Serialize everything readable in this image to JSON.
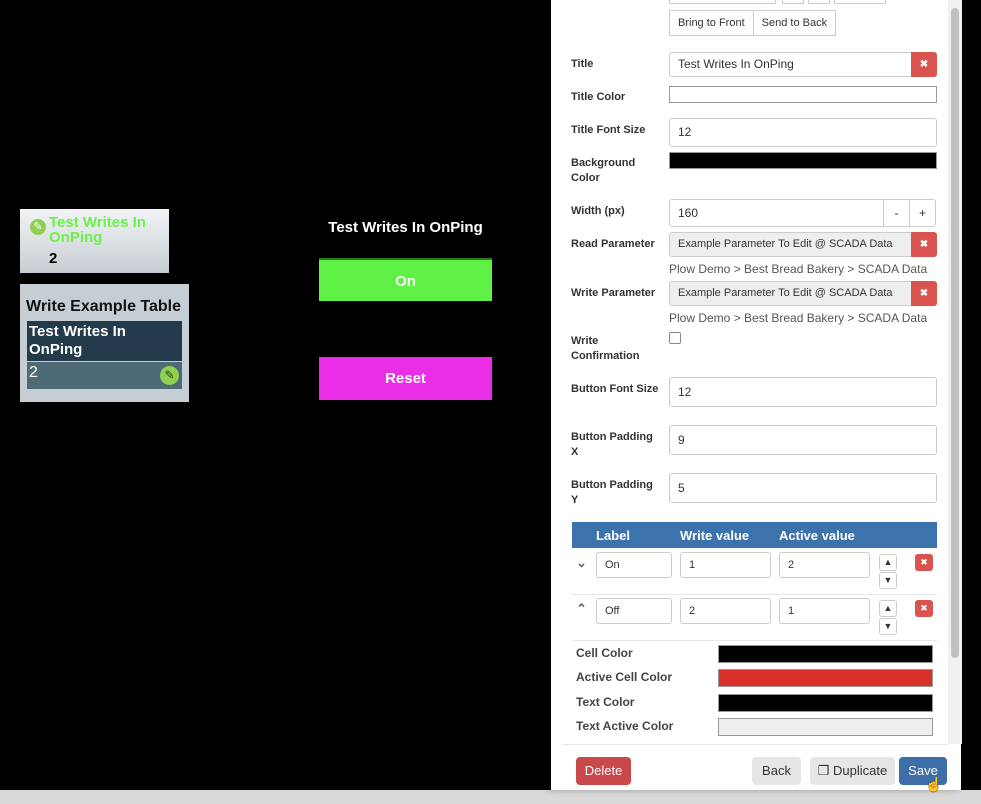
{
  "canvas": {
    "mini_card": {
      "title": "Test Writes In OnPing",
      "value": "2",
      "edit_icon": "pencil-icon"
    },
    "write_table": {
      "title": "Write Example Table",
      "header": "Test Writes In OnPing",
      "value": "2",
      "edit_icon": "pencil-icon"
    },
    "button_widget": {
      "title": "Test Writes In OnPing",
      "on_label": "On",
      "on_color": "#5ef045",
      "reset_label": "Reset",
      "reset_color": "#ea2ee8"
    }
  },
  "panel": {
    "order_buttons": [
      "Bring to Front",
      "Send to Back"
    ],
    "fields": {
      "title": {
        "label": "Title",
        "value": "Test Writes In OnPing"
      },
      "title_color": {
        "label": "Title Color",
        "value": "#ffffff"
      },
      "title_font_size": {
        "label": "Title Font Size",
        "value": "12"
      },
      "background_color": {
        "label": "Background Color",
        "value": "#000000"
      },
      "width": {
        "label": "Width (px)",
        "value": "160",
        "minus": "-",
        "plus": "+"
      },
      "read_parameter": {
        "label": "Read Parameter",
        "value": "Example Parameter To Edit @ SCADA Data",
        "hint": "Plow Demo > Best Bread Bakery > SCADA Data"
      },
      "write_parameter": {
        "label": "Write Parameter",
        "value": "Example Parameter To Edit @ SCADA Data",
        "hint": "Plow Demo > Best Bread Bakery > SCADA Data"
      },
      "write_confirmation": {
        "label": "Write Confirmation",
        "checked": false
      },
      "button_font_size": {
        "label": "Button Font Size",
        "value": "12"
      },
      "button_padding_x": {
        "label": "Button Padding X",
        "value": "9"
      },
      "button_padding_y": {
        "label": "Button Padding Y",
        "value": "5"
      }
    },
    "states_table": {
      "headers": [
        "Label",
        "Write value",
        "Active value"
      ],
      "rows": [
        {
          "label": "On",
          "write": "1",
          "active": "2",
          "expand_icon": "chevron-down-icon"
        },
        {
          "label": "Off",
          "write": "2",
          "active": "1",
          "expand_icon": "chevron-up-icon"
        }
      ]
    },
    "colors": [
      {
        "label": "Cell Color",
        "value": "#000000"
      },
      {
        "label": "Active Cell Color",
        "value": "#d9302a"
      },
      {
        "label": "Text Color",
        "value": "#000000"
      },
      {
        "label": "Text Active Color",
        "value": "#eeeeee"
      }
    ],
    "footer": {
      "delete": "Delete",
      "back": "Back",
      "duplicate": "Duplicate",
      "duplicate_icon": "copy-icon",
      "save": "Save"
    },
    "remove_icon": "close-icon"
  }
}
